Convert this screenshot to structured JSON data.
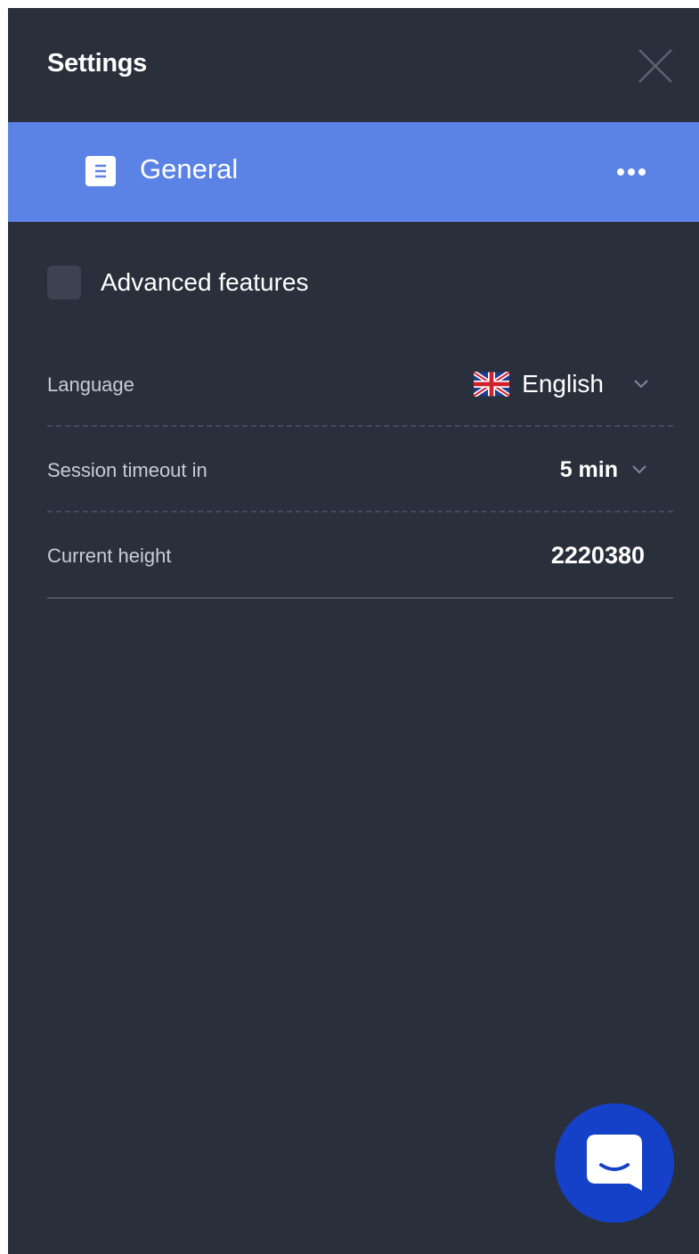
{
  "header": {
    "title": "Settings",
    "close_icon": "close-icon"
  },
  "section": {
    "label": "General",
    "icon": "document-icon",
    "more_icon": "more-horizontal-icon",
    "accent_color": "#5b83e6"
  },
  "advanced_features": {
    "label": "Advanced features",
    "checked": false
  },
  "settings": {
    "language": {
      "label": "Language",
      "value": "English",
      "flag_icon": "uk-flag-icon",
      "chevron_icon": "chevron-down-icon"
    },
    "session_timeout": {
      "label": "Session timeout in",
      "value": "5 min",
      "chevron_icon": "chevron-down-icon"
    },
    "current_height": {
      "label": "Current height",
      "value": "2220380"
    }
  },
  "chat": {
    "icon": "chat-icon",
    "color": "#1541c9"
  },
  "colors": {
    "background": "#2a2f3c"
  }
}
